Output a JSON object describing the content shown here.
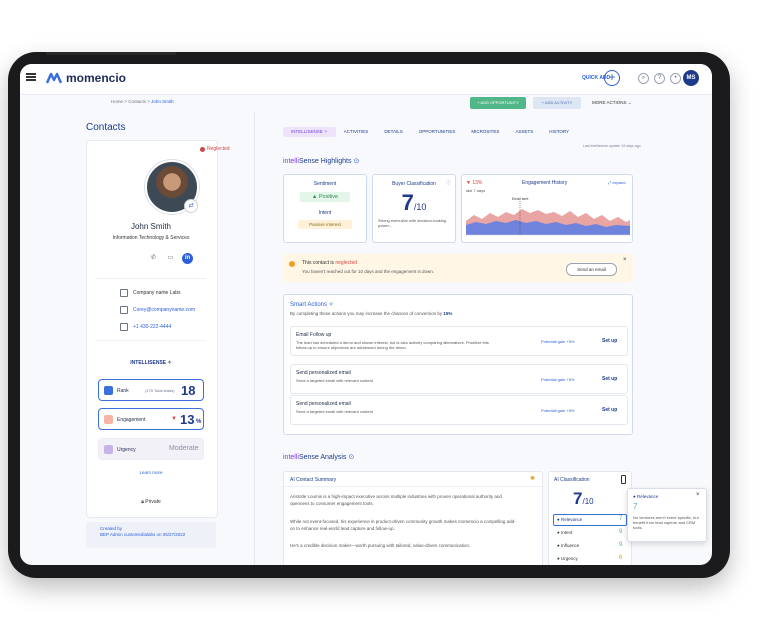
{
  "app": {
    "logo": "momencio",
    "quick_add": "QUICK ADD",
    "plus": "+",
    "user_initials": "MS"
  },
  "breadcrumb": {
    "home": "Home",
    "sep": ">",
    "contacts": "Contacts",
    "current": "John Smith"
  },
  "header_actions": {
    "add_opportunity": "+ ADD OPPORTUNITY",
    "add_activity": "+ ADD ACTIVITY",
    "more_actions": "MORE ACTIONS ⌄"
  },
  "contacts_title": "Contacts",
  "contact": {
    "status": "Neglected",
    "name": "John Smith",
    "title": "Information Technology & Services",
    "company": "Company name Labs",
    "email": "Corey@companyname.com",
    "phone": "+1 430-222-4444",
    "social": "in"
  },
  "intellisense_left": {
    "label": "INTELLISENSE ✧",
    "rank": {
      "label": "Rank",
      "total": "(175 Total leads)",
      "value": "18"
    },
    "engagement": {
      "label": "Engagement",
      "value": "13",
      "unit": "%"
    },
    "urgency": {
      "label": "Urgency",
      "value": "Moderate"
    },
    "learn_more": "Learn more"
  },
  "private_label": "Private",
  "created": {
    "line1": "Created by",
    "line2": "BEP Admin customedialabs on 05/27/2022"
  },
  "tabs": [
    "INTELLISENSE ✧",
    "ACTIVITIES",
    "DETAILS",
    "OPPORTUNITIES",
    "MICROSITES",
    "ASSETS",
    "HISTORY"
  ],
  "last_update": "Last intellisense update: 16 days ago",
  "highlights": {
    "title_prefix": "intelli",
    "title_suffix": "Sense Highlights",
    "sentiment": {
      "label": "Sentiment",
      "value": "Positive",
      "intent_label": "Intent",
      "intent_value": "Passive interest"
    },
    "buyer": {
      "label": "Buyer Classification",
      "score": "7",
      "of": "/10",
      "desc": "Strong executive with decision-making power..."
    },
    "engagement": {
      "change": "13%",
      "period": "last 7 days",
      "label": "Engagement History",
      "expand": "expand",
      "annotation": "Email sent"
    }
  },
  "alert": {
    "line1_prefix": "This contact is",
    "line1_status": "neglected",
    "line2": "You haven't reached out for 10 days and the engagement is down.",
    "button": "Send an email",
    "close": "×"
  },
  "smart_actions": {
    "title": "Smart Actions ✧",
    "subtitle_prefix": "By completing these actions you may increase the chances of conversion by",
    "subtitle_value": "15%",
    "items": [
      {
        "title": "Email Follow up",
        "desc": "The lead has scheduled a demo and shown interest, but is also actively comparing alternatives. Prioritize this follow-up to ensure objections are addressed during the demo.",
        "gain": "Potential gain +5%",
        "action": "Set up"
      },
      {
        "title": "Send personalized email",
        "desc": "Send a targeted email with relevant content",
        "gain": "Potential gain +5%",
        "action": "Set up"
      },
      {
        "title": "Send personalized email",
        "desc": "Send a targeted email with relevant content",
        "gain": "Potential gain +5%",
        "action": "Set up"
      }
    ]
  },
  "analysis": {
    "title_prefix": "intelli",
    "title_suffix": "Sense Analysis",
    "summary": {
      "title": "AI Contact Summary",
      "p1": "Aristotle Loumis is a high-impact executive across multiple industries with proven operational authority and openness to consumer engagement tools.",
      "p2": "While not event-focused, his experience in product-driven community growth makes momencio a compelling add-on to enhance real-world lead capture and follow-up.",
      "p3": "He's a credible decision maker—worth pursuing with tailored, value-driven communication."
    },
    "classification": {
      "title": "AI Classification",
      "score": "7",
      "of": "/10",
      "rows": [
        {
          "label": "Relevance",
          "value": "7"
        },
        {
          "label": "Intent",
          "value": "9"
        },
        {
          "label": "Influence",
          "value": "9"
        },
        {
          "label": "Urgency",
          "value": "6"
        }
      ]
    },
    "popup": {
      "label": "Relevance",
      "value": "7",
      "text": "No ventures aren't event specific, but benefit from lead capture and CRM tools.",
      "close": "×"
    }
  },
  "colors": {
    "accent": "#2b5fd9",
    "brand": "#1e3a8a",
    "intelli": "#7b3fe4",
    "alert": "#d64545",
    "positive": "#52b788"
  }
}
